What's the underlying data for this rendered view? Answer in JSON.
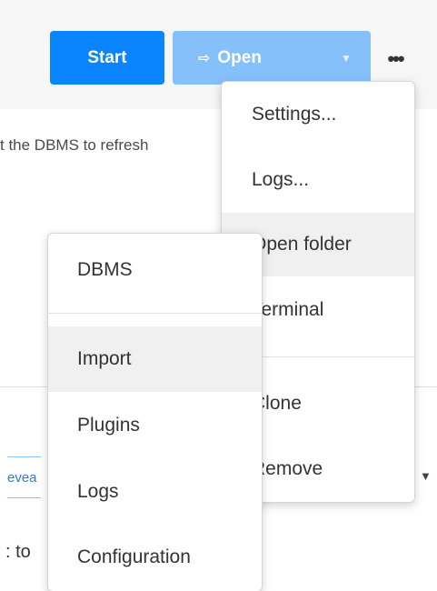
{
  "toolbar": {
    "start_label": "Start",
    "open_label": "Open",
    "open_icon": "sign-in-icon",
    "caret_icon": "caret-down-icon",
    "more_icon": "ellipsis-icon"
  },
  "background_text": {
    "info": "t the DBMS to refresh",
    "reveal_fragment": "evea",
    "to_fragment": ": to"
  },
  "more_menu": {
    "items": [
      {
        "label": "Settings..."
      },
      {
        "label": "Logs..."
      },
      {
        "label": "Open folder"
      },
      {
        "label": "Terminal"
      },
      {
        "label": "Clone"
      },
      {
        "label": "Remove"
      }
    ]
  },
  "open_menu": {
    "items": [
      {
        "label": "DBMS"
      },
      {
        "label": "Import"
      },
      {
        "label": "Plugins"
      },
      {
        "label": "Logs"
      },
      {
        "label": "Configuration"
      }
    ]
  },
  "colors": {
    "primary": "#0a84ff",
    "primary_disabled": "#86c0fb",
    "hover_bg": "#f0f0f0"
  }
}
